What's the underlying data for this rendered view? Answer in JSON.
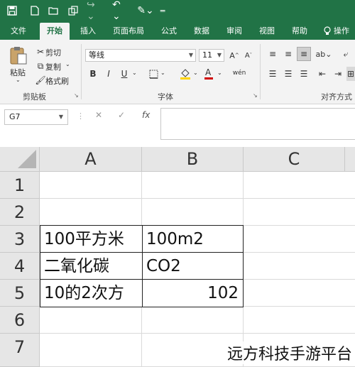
{
  "quick_access": {
    "save_icon": "save-icon",
    "new_icon": "new-document-icon",
    "undo_icon": "undo-icon",
    "redo_icon": "redo-icon",
    "format_painter_icon": "format-painter-icon",
    "customize_icon": "customize-icon"
  },
  "tabs": [
    {
      "label": "文件",
      "active": false
    },
    {
      "label": "开始",
      "active": true
    },
    {
      "label": "插入",
      "active": false
    },
    {
      "label": "页面布局",
      "active": false
    },
    {
      "label": "公式",
      "active": false
    },
    {
      "label": "数据",
      "active": false
    },
    {
      "label": "审阅",
      "active": false
    },
    {
      "label": "视图",
      "active": false
    },
    {
      "label": "帮助",
      "active": false
    },
    {
      "label": "操作",
      "active": false
    }
  ],
  "ribbon": {
    "clipboard": {
      "paste_label": "粘贴",
      "cut_label": "剪切",
      "copy_label": "复制",
      "format_painter_label": "格式刷",
      "group_label": "剪贴板"
    },
    "font": {
      "font_name": "等线",
      "font_size": "11",
      "bold": "B",
      "italic": "I",
      "underline": "U",
      "group_label": "字体"
    },
    "alignment": {
      "group_label": "对齐方式"
    }
  },
  "formula_bar": {
    "name_box": "G7",
    "cancel": "✕",
    "enter": "✓",
    "fx": "fx",
    "content": ""
  },
  "grid": {
    "columns": [
      "A",
      "B",
      "C"
    ],
    "rows": [
      "1",
      "2",
      "3",
      "4",
      "5",
      "6",
      "7"
    ],
    "cells": {
      "A3": "100平方米",
      "B3": "100m2",
      "A4": "二氧化碳",
      "B4": "CO2",
      "A5": "10的2次方",
      "B5": "102"
    }
  },
  "watermark": "远方科技手游平台",
  "colors": {
    "brand": "#217346",
    "ribbon_bg": "#f3f3f3"
  }
}
